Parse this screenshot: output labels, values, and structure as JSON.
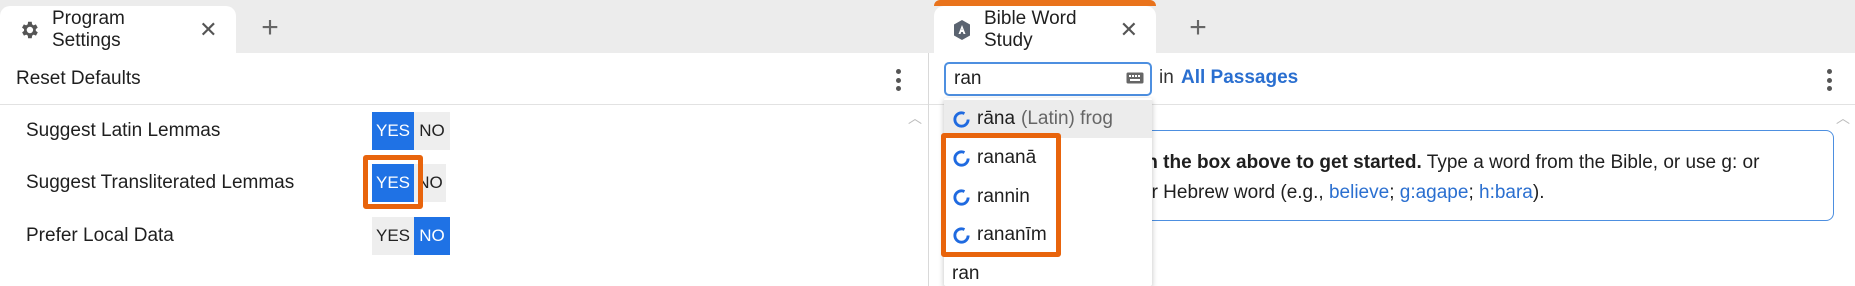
{
  "left_panel": {
    "tab_title": "Program Settings",
    "tab_close": "✕",
    "new_tab": "+",
    "toolbar": {
      "reset_label": "Reset Defaults"
    },
    "settings": [
      {
        "label": "Suggest Latin Lemmas",
        "yes": "YES",
        "no": "NO",
        "value": "YES"
      },
      {
        "label": "Suggest Transliterated Lemmas",
        "yes": "YES",
        "no": "NO",
        "value": "YES"
      },
      {
        "label": "Prefer Local Data",
        "yes": "YES",
        "no": "NO",
        "value": "NO"
      }
    ]
  },
  "right_panel": {
    "tab_title": "Bible Word Study",
    "tab_close": "✕",
    "new_tab": "+",
    "search": {
      "value": "ran"
    },
    "in_label": "in",
    "scope_link": "All Passages",
    "dropdown": [
      {
        "text": "rāna",
        "detail": "(Latin) frog",
        "icon": "logos-icon"
      },
      {
        "text": "rananā",
        "icon": "logos-icon"
      },
      {
        "text": "rannin",
        "icon": "logos-icon"
      },
      {
        "text": "rananīm",
        "icon": "logos-icon"
      },
      {
        "text": "ran"
      }
    ],
    "info": {
      "bold": "in the box above to get started.",
      "text1": " Type a word from the Bible, or use g: or",
      "text2_start": "or Hebrew word (e.g., ",
      "ex1": "believe",
      "sep1": "; ",
      "ex2": "g:agape",
      "sep2": "; ",
      "ex3": "h:bara",
      "end": ")."
    }
  },
  "colors": {
    "accent": "#1f72e5",
    "highlight": "#e8640c",
    "link": "#2a6fd0"
  }
}
